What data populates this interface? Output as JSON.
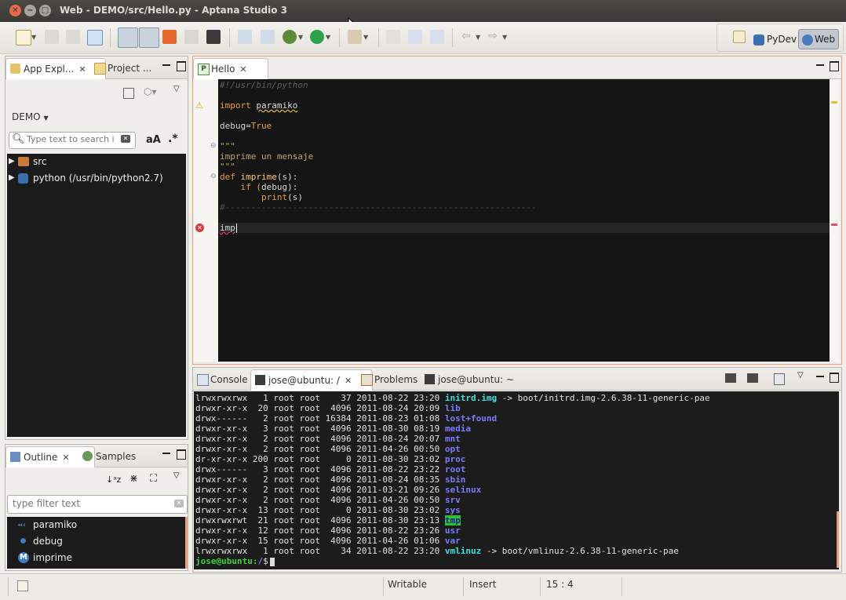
{
  "window": {
    "title": "Web - DEMO/src/Hello.py - Aptana Studio 3"
  },
  "perspectives": {
    "pydev": "PyDev",
    "web": "Web"
  },
  "left_panel": {
    "tabs": [
      {
        "label": "App Expl..."
      },
      {
        "label": "Project ..."
      }
    ],
    "project": "DEMO",
    "search_placeholder": "Type text to search i",
    "case_toggle": "aA",
    "regex_toggle": ".*",
    "tree": [
      {
        "label": "src"
      },
      {
        "label": "python  (/usr/bin/python2.7)"
      }
    ]
  },
  "outline_panel": {
    "tabs": [
      {
        "label": "Outline"
      },
      {
        "label": "Samples"
      }
    ],
    "filter_placeholder": "type filter text",
    "items": [
      {
        "label": "paramiko"
      },
      {
        "label": "debug"
      },
      {
        "label": "imprime"
      }
    ]
  },
  "editor": {
    "tab": "Hello",
    "lines": {
      "l1": "#!/usr/bin/python",
      "l3a": "import ",
      "l3b": "paramiko",
      "l5a": "debug=",
      "l5b": "True",
      "l7": "\"\"\"",
      "l8": "imprime un mensaje",
      "l9": "\"\"\"",
      "l10a": "def ",
      "l10b": "imprime",
      "l10c": "(s):",
      "l11a": "    if (",
      "l11b": "debug",
      "l11c": "):",
      "l12a": "        ",
      "l12b": "print",
      "l12c": "(s)",
      "l13": "#------------------------------------------------------------",
      "l15": "imp"
    }
  },
  "console": {
    "tabs": [
      {
        "label": "Console"
      },
      {
        "label": "jose@ubuntu: /"
      },
      {
        "label": "Problems"
      },
      {
        "label": "jose@ubuntu: ~"
      }
    ],
    "lines": [
      {
        "meta": "lrwxrwxrwx   1 root root    37 2011-08-22 23:20 ",
        "name": "initrd.img",
        "kind": "lnk",
        "target": " -> boot/initrd.img-2.6.38-11-generic-pae"
      },
      {
        "meta": "drwxr-xr-x  20 root root  4096 2011-08-24 20:09 ",
        "name": "lib",
        "kind": "dir",
        "target": ""
      },
      {
        "meta": "drwx------   2 root root 16384 2011-08-23 01:08 ",
        "name": "lost+found",
        "kind": "dir",
        "target": ""
      },
      {
        "meta": "drwxr-xr-x   3 root root  4096 2011-08-30 08:19 ",
        "name": "media",
        "kind": "dir",
        "target": ""
      },
      {
        "meta": "drwxr-xr-x   2 root root  4096 2011-08-24 20:07 ",
        "name": "mnt",
        "kind": "dir",
        "target": ""
      },
      {
        "meta": "drwxr-xr-x   2 root root  4096 2011-04-26 00:50 ",
        "name": "opt",
        "kind": "dir",
        "target": ""
      },
      {
        "meta": "dr-xr-xr-x 200 root root     0 2011-08-30 23:02 ",
        "name": "proc",
        "kind": "dir",
        "target": ""
      },
      {
        "meta": "drwx------   3 root root  4096 2011-08-22 23:22 ",
        "name": "root",
        "kind": "dir",
        "target": ""
      },
      {
        "meta": "drwxr-xr-x   2 root root  4096 2011-08-24 08:35 ",
        "name": "sbin",
        "kind": "dir",
        "target": ""
      },
      {
        "meta": "drwxr-xr-x   2 root root  4096 2011-03-21 09:26 ",
        "name": "selinux",
        "kind": "dir",
        "target": ""
      },
      {
        "meta": "drwxr-xr-x   2 root root  4096 2011-04-26 00:50 ",
        "name": "srv",
        "kind": "dir",
        "target": ""
      },
      {
        "meta": "drwxr-xr-x  13 root root     0 2011-08-30 23:02 ",
        "name": "sys",
        "kind": "dir",
        "target": ""
      },
      {
        "meta": "drwxrwxrwt  21 root root  4096 2011-08-30 23:13 ",
        "name": "tmp",
        "kind": "tmp",
        "target": ""
      },
      {
        "meta": "drwxr-xr-x  12 root root  4096 2011-08-22 23:26 ",
        "name": "usr",
        "kind": "dir",
        "target": ""
      },
      {
        "meta": "drwxr-xr-x  15 root root  4096 2011-04-26 01:06 ",
        "name": "var",
        "kind": "dir",
        "target": ""
      },
      {
        "meta": "lrwxrwxrwx   1 root root    34 2011-08-22 23:20 ",
        "name": "vmlinuz",
        "kind": "lnk",
        "target": " -> boot/vmlinuz-2.6.38-11-generic-pae"
      }
    ],
    "prompt_user": "jose@ubuntu:",
    "prompt_path": "/",
    "prompt_symbol": "$"
  },
  "status": {
    "writable": "Writable",
    "insert": "Insert",
    "position": "15 : 4"
  },
  "colors": {
    "accent": "#e8a07e",
    "editor_bg": "#151515",
    "prompt": "#3fd13f",
    "dir": "#7b7bff"
  }
}
